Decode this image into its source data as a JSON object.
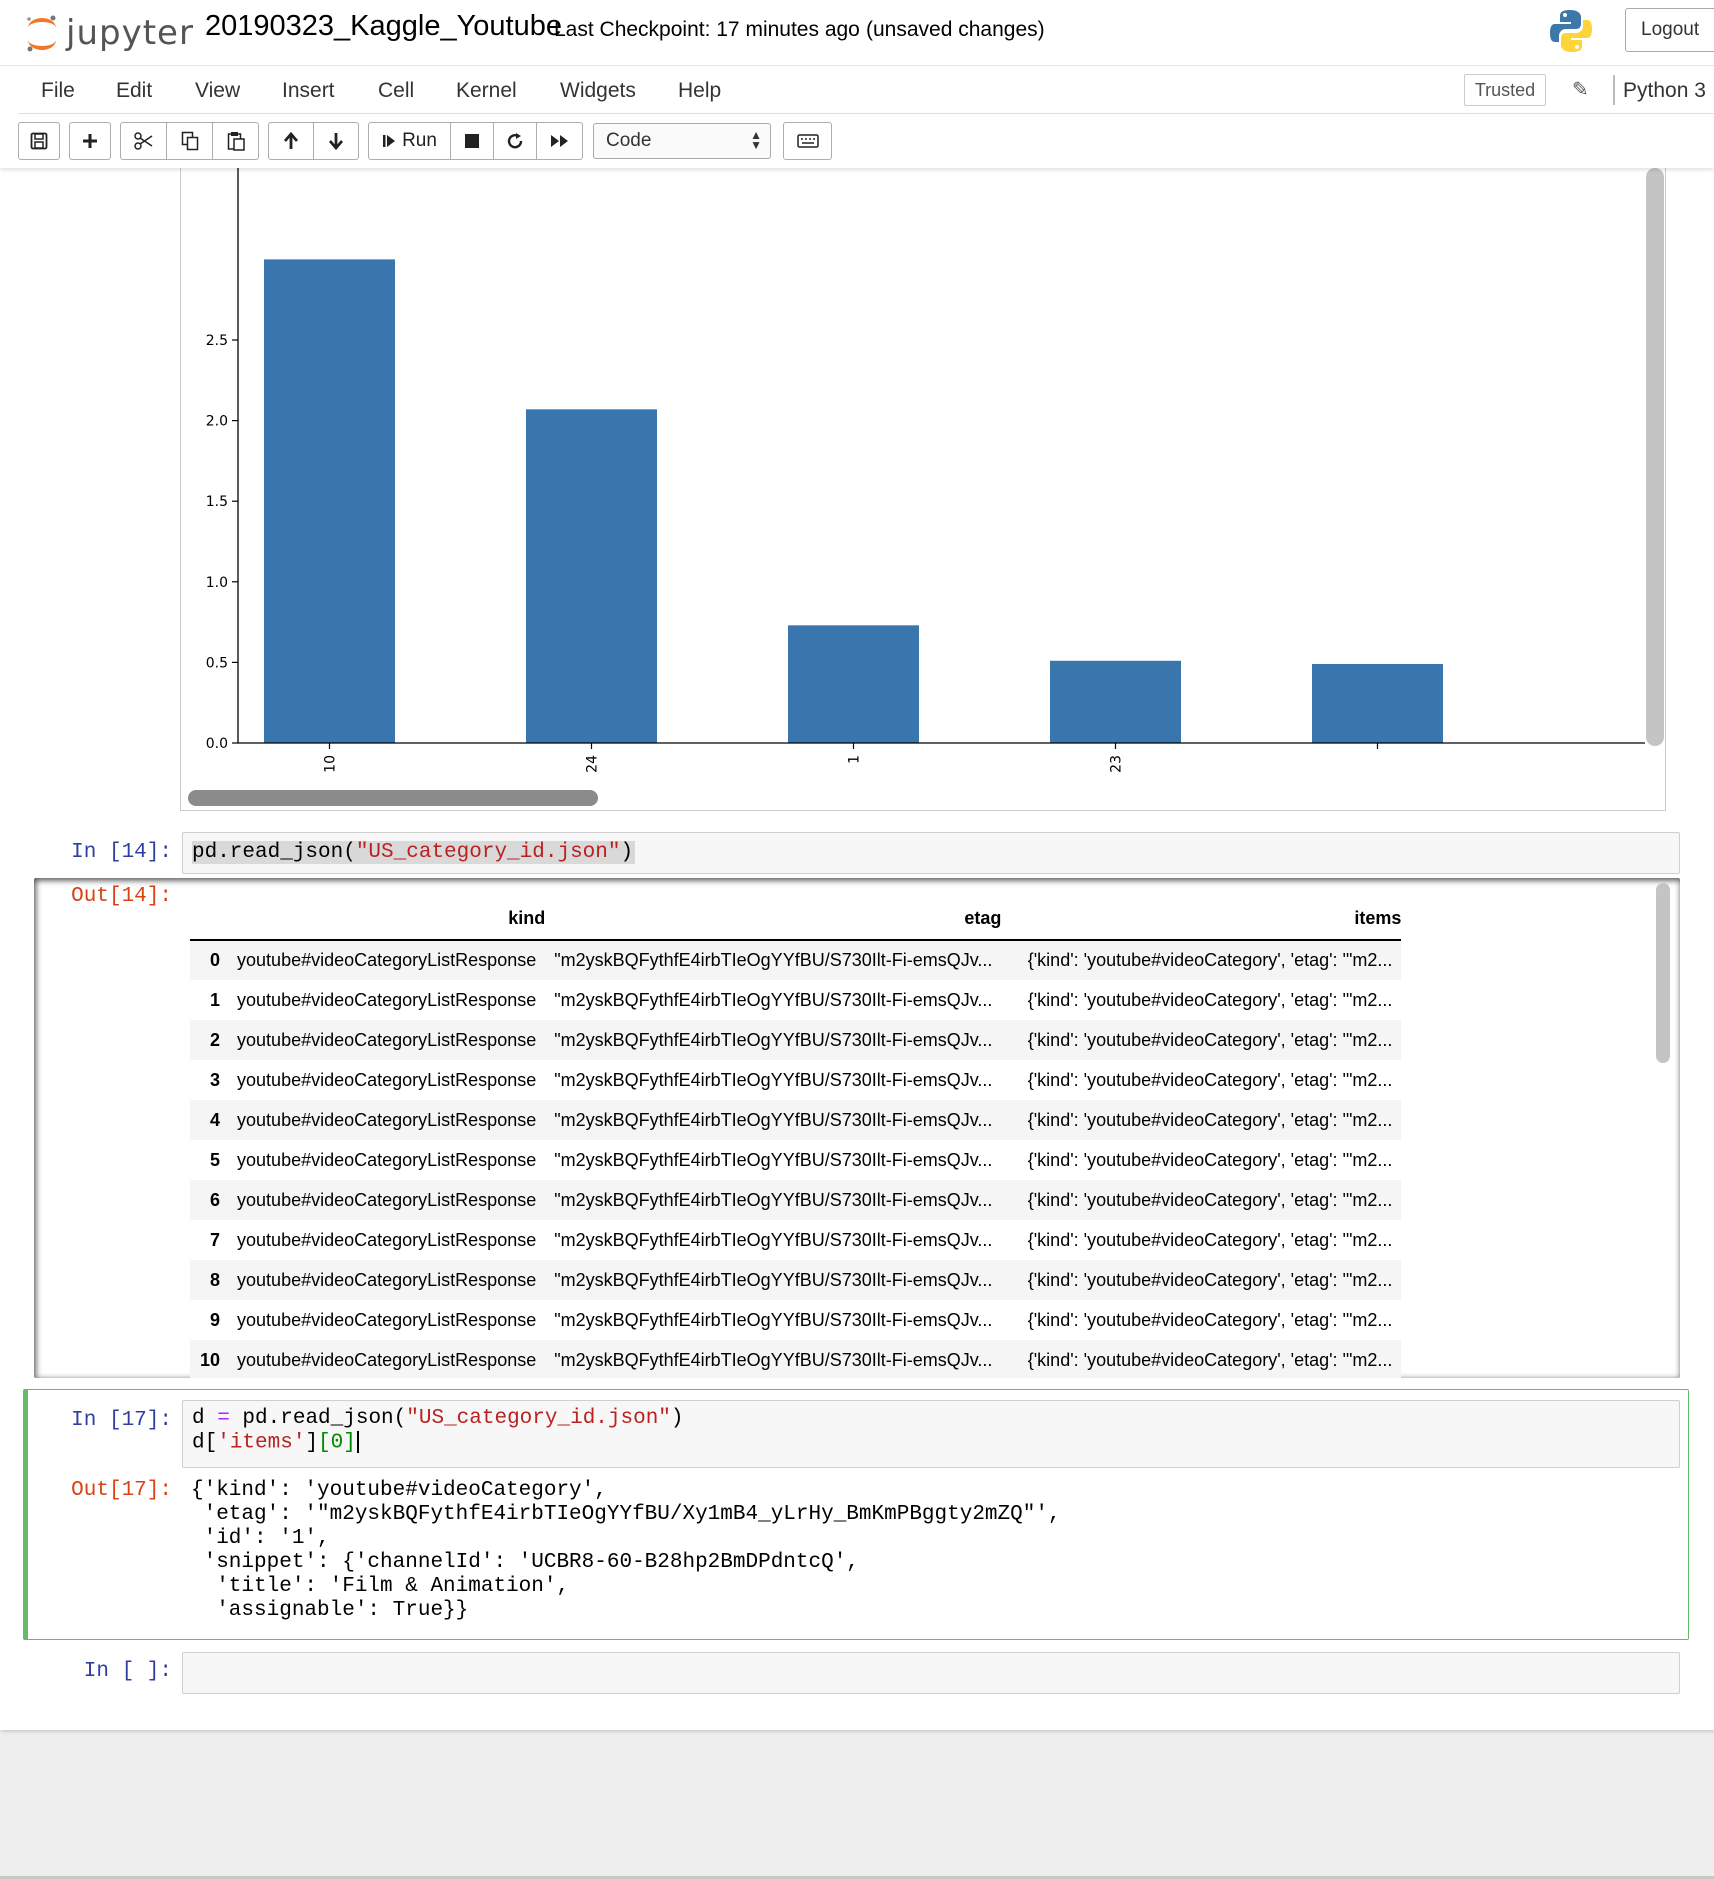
{
  "header": {
    "logo_text": "jupyter",
    "notebook_name": "20190323_Kaggle_Youtube",
    "checkpoint": "Last Checkpoint: 17 minutes ago",
    "save_status": "(unsaved changes)",
    "logout_label": "Logout"
  },
  "menubar": {
    "items": [
      "File",
      "Edit",
      "View",
      "Insert",
      "Cell",
      "Kernel",
      "Widgets",
      "Help"
    ],
    "trusted_label": "Trusted",
    "kernel_name": "Python 3"
  },
  "toolbar": {
    "run_label": "Run",
    "cell_type": "Code"
  },
  "chart_data": {
    "type": "bar",
    "categories": [
      "10",
      "24",
      "1",
      "23",
      ""
    ],
    "values": [
      3.0,
      2.07,
      0.73,
      0.51,
      0.49
    ],
    "y_ticks": [
      "0.0",
      "0.5",
      "1.0",
      "1.5",
      "2.0",
      "2.5"
    ],
    "ylim": [
      0,
      2.97
    ],
    "bar_color": "#3a76ae",
    "title": "",
    "xlabel": "",
    "ylabel": "",
    "grid": false
  },
  "cell14": {
    "prompt_in": "In [14]:",
    "prompt_out": "Out[14]:",
    "code_func": "pd.read_json(",
    "code_str": "\"US_category_id.json\"",
    "code_close": ")",
    "table": {
      "columns": [
        "",
        "kind",
        "etag",
        "items"
      ],
      "rows": [
        {
          "index": "0",
          "kind": "youtube#videoCategoryListResponse",
          "etag": "\"m2yskBQFythfE4irbTIeOgYYfBU/S730Ilt-Fi-emsQJv...",
          "items": "{'kind': 'youtube#videoCategory', 'etag': '\"m2..."
        },
        {
          "index": "1",
          "kind": "youtube#videoCategoryListResponse",
          "etag": "\"m2yskBQFythfE4irbTIeOgYYfBU/S730Ilt-Fi-emsQJv...",
          "items": "{'kind': 'youtube#videoCategory', 'etag': '\"m2..."
        },
        {
          "index": "2",
          "kind": "youtube#videoCategoryListResponse",
          "etag": "\"m2yskBQFythfE4irbTIeOgYYfBU/S730Ilt-Fi-emsQJv...",
          "items": "{'kind': 'youtube#videoCategory', 'etag': '\"m2..."
        },
        {
          "index": "3",
          "kind": "youtube#videoCategoryListResponse",
          "etag": "\"m2yskBQFythfE4irbTIeOgYYfBU/S730Ilt-Fi-emsQJv...",
          "items": "{'kind': 'youtube#videoCategory', 'etag': '\"m2..."
        },
        {
          "index": "4",
          "kind": "youtube#videoCategoryListResponse",
          "etag": "\"m2yskBQFythfE4irbTIeOgYYfBU/S730Ilt-Fi-emsQJv...",
          "items": "{'kind': 'youtube#videoCategory', 'etag': '\"m2..."
        },
        {
          "index": "5",
          "kind": "youtube#videoCategoryListResponse",
          "etag": "\"m2yskBQFythfE4irbTIeOgYYfBU/S730Ilt-Fi-emsQJv...",
          "items": "{'kind': 'youtube#videoCategory', 'etag': '\"m2..."
        },
        {
          "index": "6",
          "kind": "youtube#videoCategoryListResponse",
          "etag": "\"m2yskBQFythfE4irbTIeOgYYfBU/S730Ilt-Fi-emsQJv...",
          "items": "{'kind': 'youtube#videoCategory', 'etag': '\"m2..."
        },
        {
          "index": "7",
          "kind": "youtube#videoCategoryListResponse",
          "etag": "\"m2yskBQFythfE4irbTIeOgYYfBU/S730Ilt-Fi-emsQJv...",
          "items": "{'kind': 'youtube#videoCategory', 'etag': '\"m2..."
        },
        {
          "index": "8",
          "kind": "youtube#videoCategoryListResponse",
          "etag": "\"m2yskBQFythfE4irbTIeOgYYfBU/S730Ilt-Fi-emsQJv...",
          "items": "{'kind': 'youtube#videoCategory', 'etag': '\"m2..."
        },
        {
          "index": "9",
          "kind": "youtube#videoCategoryListResponse",
          "etag": "\"m2yskBQFythfE4irbTIeOgYYfBU/S730Ilt-Fi-emsQJv...",
          "items": "{'kind': 'youtube#videoCategory', 'etag': '\"m2..."
        },
        {
          "index": "10",
          "kind": "youtube#videoCategoryListResponse",
          "etag": "\"m2yskBQFythfE4irbTIeOgYYfBU/S730Ilt-Fi-emsQJv...",
          "items": "{'kind': 'youtube#videoCategory', 'etag': '\"m2..."
        }
      ]
    }
  },
  "cell17": {
    "prompt_in": "In [17]:",
    "prompt_out": "Out[17]:",
    "code_line1_a": "d ",
    "code_line1_op": "=",
    "code_line1_b": " pd.read_json(",
    "code_line1_str": "\"US_category_id.json\"",
    "code_line1_c": ")",
    "code_line2_a": "d[",
    "code_line2_str": "'items'",
    "code_line2_b": "]",
    "code_line2_num": "[0]",
    "output_lines": [
      "{'kind': 'youtube#videoCategory',",
      " 'etag': '\"m2yskBQFythfE4irbTIeOgYYfBU/Xy1mB4_yLrHy_BmKmPBggty2mZQ\"',",
      " 'id': '1',",
      " 'snippet': {'channelId': 'UCBR8-60-B28hp2BmDPdntcQ',",
      "  'title': 'Film & Animation',",
      "  'assignable': True}}"
    ]
  },
  "cell_empty": {
    "prompt_in": "In [ ]:"
  }
}
